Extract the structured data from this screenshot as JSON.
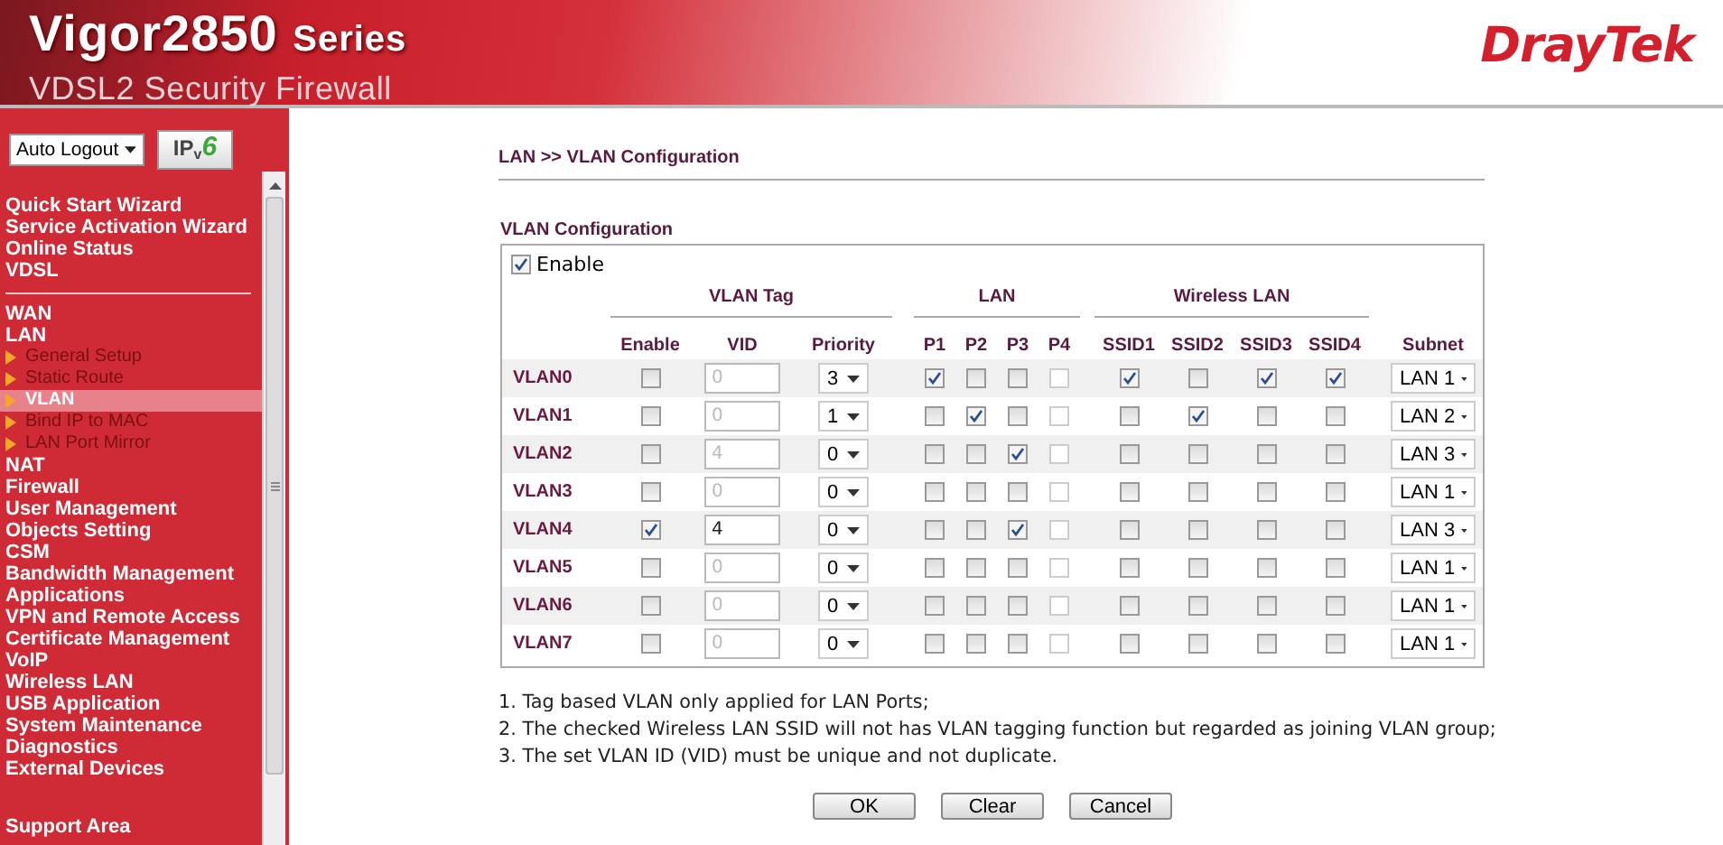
{
  "header": {
    "product": "Vigor2850",
    "series": "Series",
    "subtitle": "VDSL2 Security Firewall",
    "brand": "DrayTek"
  },
  "sidebar": {
    "auto_logout": "Auto Logout",
    "ipv6": {
      "ip": "IP",
      "v": "v",
      "six": "6"
    },
    "groups": [
      [
        {
          "label": "Quick Start Wizard",
          "selected": false
        },
        {
          "label": "Service Activation Wizard",
          "selected": false
        },
        {
          "label": "Online Status",
          "selected": false
        },
        {
          "label": "VDSL",
          "selected": false
        }
      ],
      [
        {
          "label": "WAN",
          "selected": false
        },
        {
          "label": "LAN",
          "selected": false,
          "children": [
            {
              "label": "General Setup",
              "selected": false
            },
            {
              "label": "Static Route",
              "selected": false
            },
            {
              "label": "VLAN",
              "selected": true
            },
            {
              "label": "Bind IP to MAC",
              "selected": false
            },
            {
              "label": "LAN Port Mirror",
              "selected": false
            }
          ]
        },
        {
          "label": "NAT",
          "selected": false
        },
        {
          "label": "Firewall",
          "selected": false
        },
        {
          "label": "User Management",
          "selected": false
        },
        {
          "label": "Objects Setting",
          "selected": false
        },
        {
          "label": "CSM",
          "selected": false
        },
        {
          "label": "Bandwidth Management",
          "selected": false
        },
        {
          "label": "Applications",
          "selected": false
        },
        {
          "label": "VPN and Remote Access",
          "selected": false
        },
        {
          "label": "Certificate Management",
          "selected": false
        },
        {
          "label": "VoIP",
          "selected": false
        },
        {
          "label": "Wireless LAN",
          "selected": false
        },
        {
          "label": "USB Application",
          "selected": false
        },
        {
          "label": "System Maintenance",
          "selected": false
        },
        {
          "label": "Diagnostics",
          "selected": false
        },
        {
          "label": "External Devices",
          "selected": false
        }
      ]
    ],
    "support": "Support Area"
  },
  "breadcrumb": "LAN >> VLAN Configuration",
  "section_title": "VLAN Configuration",
  "enable": {
    "label": "Enable",
    "checked": true
  },
  "groups": {
    "vlan_tag": "VLAN Tag",
    "lan": "LAN",
    "wireless": "Wireless LAN"
  },
  "columns": {
    "enable": "Enable",
    "vid": "VID",
    "priority": "Priority",
    "lan_ports": [
      {
        "label": "P1",
        "disabled": false
      },
      {
        "label": "P2",
        "disabled": false
      },
      {
        "label": "P3",
        "disabled": false
      },
      {
        "label": "P4",
        "disabled": true
      }
    ],
    "ssids": [
      "SSID1",
      "SSID2",
      "SSID3",
      "SSID4"
    ],
    "subnet": "Subnet"
  },
  "rows": [
    {
      "name": "VLAN0",
      "enable": false,
      "vid": "0",
      "priority": "3",
      "lan": [
        true,
        false,
        false,
        false
      ],
      "ssid": [
        true,
        false,
        true,
        true
      ],
      "subnet": "LAN 1"
    },
    {
      "name": "VLAN1",
      "enable": false,
      "vid": "0",
      "priority": "1",
      "lan": [
        false,
        true,
        false,
        false
      ],
      "ssid": [
        false,
        true,
        false,
        false
      ],
      "subnet": "LAN 2"
    },
    {
      "name": "VLAN2",
      "enable": false,
      "vid": "4",
      "priority": "0",
      "lan": [
        false,
        false,
        true,
        false
      ],
      "ssid": [
        false,
        false,
        false,
        false
      ],
      "subnet": "LAN 3"
    },
    {
      "name": "VLAN3",
      "enable": false,
      "vid": "0",
      "priority": "0",
      "lan": [
        false,
        false,
        false,
        false
      ],
      "ssid": [
        false,
        false,
        false,
        false
      ],
      "subnet": "LAN 1"
    },
    {
      "name": "VLAN4",
      "enable": true,
      "vid": "4",
      "priority": "0",
      "lan": [
        false,
        false,
        true,
        false
      ],
      "ssid": [
        false,
        false,
        false,
        false
      ],
      "subnet": "LAN 3"
    },
    {
      "name": "VLAN5",
      "enable": false,
      "vid": "0",
      "priority": "0",
      "lan": [
        false,
        false,
        false,
        false
      ],
      "ssid": [
        false,
        false,
        false,
        false
      ],
      "subnet": "LAN 1"
    },
    {
      "name": "VLAN6",
      "enable": false,
      "vid": "0",
      "priority": "0",
      "lan": [
        false,
        false,
        false,
        false
      ],
      "ssid": [
        false,
        false,
        false,
        false
      ],
      "subnet": "LAN 1"
    },
    {
      "name": "VLAN7",
      "enable": false,
      "vid": "0",
      "priority": "0",
      "lan": [
        false,
        false,
        false,
        false
      ],
      "ssid": [
        false,
        false,
        false,
        false
      ],
      "subnet": "LAN 1"
    }
  ],
  "notes": [
    "1. Tag based VLAN only applied for LAN Ports;",
    "2. The checked Wireless LAN SSID will not has VLAN tagging function but regarded as joining VLAN group;",
    "3. The set VLAN ID (VID) must be unique and not duplicate."
  ],
  "buttons": [
    "OK",
    "Clear",
    "Cancel"
  ]
}
